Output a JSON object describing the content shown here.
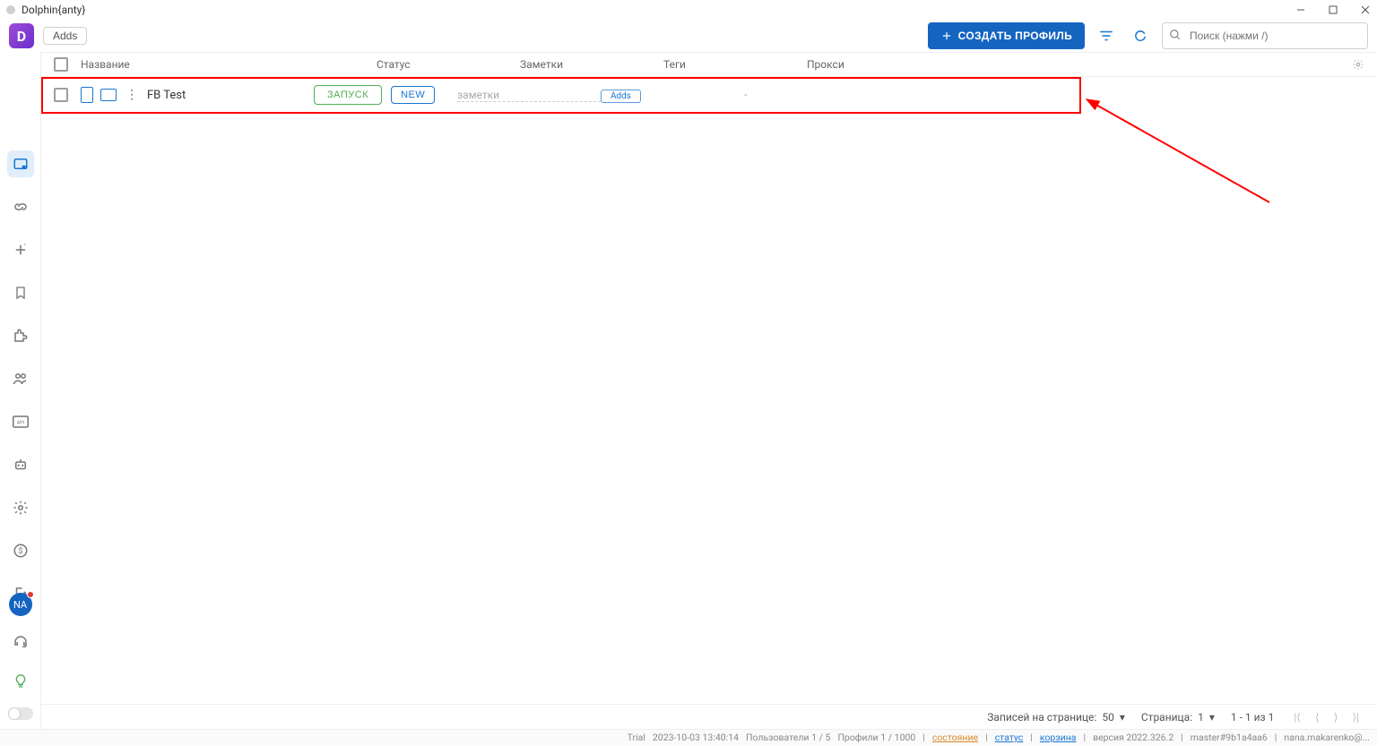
{
  "window": {
    "title": "Dolphin{anty}"
  },
  "topbar": {
    "adds_label": "Adds",
    "create_label": "СОЗДАТЬ ПРОФИЛЬ",
    "search_placeholder": "Поиск (нажми /)"
  },
  "table": {
    "headers": {
      "name": "Название",
      "status": "Статус",
      "notes": "Заметки",
      "tags": "Теги",
      "proxy": "Прокси"
    },
    "rows": [
      {
        "name": "FB Test",
        "launch_label": "ЗАПУСК",
        "status_badge": "NEW",
        "notes_placeholder": "заметки",
        "tag_btn": "Adds",
        "proxy": "-"
      }
    ]
  },
  "sidebar": {
    "avatar": "NA"
  },
  "footer": {
    "per_page_label": "Записей на странице:",
    "per_page_value": "50",
    "page_label": "Страница:",
    "page_value": "1",
    "range": "1 - 1 из 1"
  },
  "statusbar": {
    "trial": "Trial",
    "datetime": "2023-10-03 13:40:14",
    "users": "Пользователи 1 / 5",
    "profiles": "Профили 1 / 1000",
    "link_sost": "состояние",
    "link_status": "статус",
    "link_trash": "корзина",
    "version": "версия 2022.326.2",
    "build": "master#9b1a4aa6",
    "email": "nana.makarenko@..."
  },
  "colors": {
    "primary": "#1565c0",
    "green": "#4caf50",
    "annotation": "#ff0000"
  }
}
